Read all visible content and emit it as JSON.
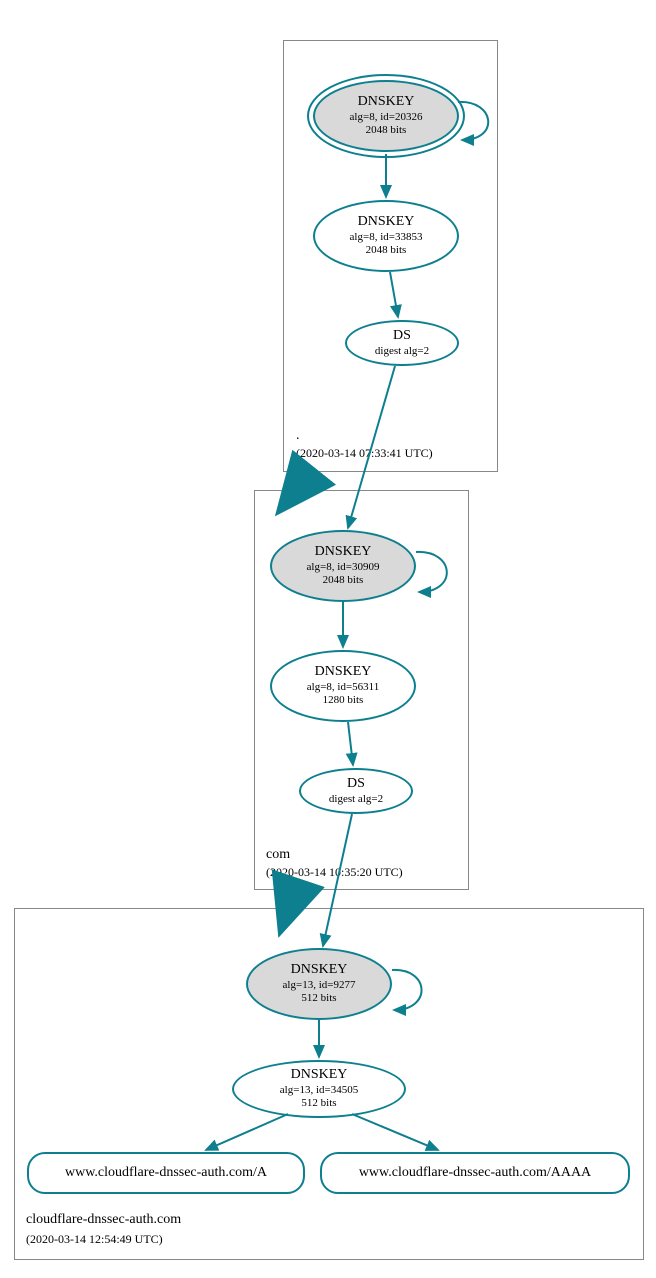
{
  "zones": {
    "root": {
      "name": ".",
      "timestamp": "(2020-03-14 07:33:41 UTC)"
    },
    "com": {
      "name": "com",
      "timestamp": "(2020-03-14 10:35:20 UTC)"
    },
    "leaf": {
      "name": "cloudflare-dnssec-auth.com",
      "timestamp": "(2020-03-14 12:54:49 UTC)"
    }
  },
  "nodes": {
    "root_ksk": {
      "title": "DNSKEY",
      "alg": "alg=8, id=20326",
      "bits": "2048 bits"
    },
    "root_zsk": {
      "title": "DNSKEY",
      "alg": "alg=8, id=33853",
      "bits": "2048 bits"
    },
    "root_ds": {
      "title": "DS",
      "digest": "digest alg=2"
    },
    "com_ksk": {
      "title": "DNSKEY",
      "alg": "alg=8, id=30909",
      "bits": "2048 bits"
    },
    "com_zsk": {
      "title": "DNSKEY",
      "alg": "alg=8, id=56311",
      "bits": "1280 bits"
    },
    "com_ds": {
      "title": "DS",
      "digest": "digest alg=2"
    },
    "leaf_ksk": {
      "title": "DNSKEY",
      "alg": "alg=13, id=9277",
      "bits": "512 bits"
    },
    "leaf_zsk": {
      "title": "DNSKEY",
      "alg": "alg=13, id=34505",
      "bits": "512 bits"
    },
    "rr_a": {
      "label": "www.cloudflare-dnssec-auth.com/A"
    },
    "rr_aaaa": {
      "label": "www.cloudflare-dnssec-auth.com/AAAA"
    }
  }
}
